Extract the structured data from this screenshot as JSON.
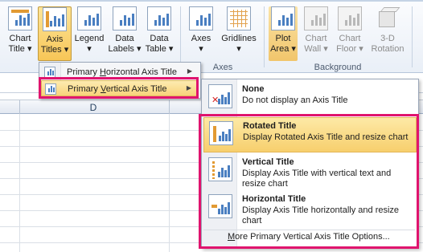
{
  "ribbon": {
    "buttons": [
      {
        "id": "chart-title",
        "line1": "Chart",
        "line2": "Title ▾"
      },
      {
        "id": "axis-titles",
        "line1": "Axis",
        "line2": "Titles ▾"
      },
      {
        "id": "legend",
        "line1": "Legend",
        "line2": "▾"
      },
      {
        "id": "data-labels",
        "line1": "Data",
        "line2": "Labels ▾"
      },
      {
        "id": "data-table",
        "line1": "Data",
        "line2": "Table ▾"
      },
      {
        "id": "axes",
        "line1": "Axes",
        "line2": "▾"
      },
      {
        "id": "gridlines",
        "line1": "Gridlines",
        "line2": "▾"
      },
      {
        "id": "plot-area",
        "line1": "Plot",
        "line2": "Area ▾"
      },
      {
        "id": "chart-wall",
        "line1": "Chart",
        "line2": "Wall ▾"
      },
      {
        "id": "chart-floor",
        "line1": "Chart",
        "line2": "Floor ▾"
      },
      {
        "id": "3d-rotation",
        "line1": "3-D",
        "line2": "Rotation"
      }
    ],
    "groups": {
      "axes": "Axes",
      "background": "Background"
    }
  },
  "sheet": {
    "column_label": "D"
  },
  "axis_titles_menu": {
    "items": [
      {
        "label_pre": "Primary ",
        "label_accel": "H",
        "label_post": "orizontal Axis Title"
      },
      {
        "label_pre": "Primary ",
        "label_accel": "V",
        "label_post": "ertical Axis Title"
      }
    ]
  },
  "vertical_axis_submenu": {
    "items": [
      {
        "title": "None",
        "desc": "Do not display an Axis Title"
      },
      {
        "title": "Rotated Title",
        "desc": "Display Rotated Axis Title and resize chart"
      },
      {
        "title": "Vertical Title",
        "desc": "Display Axis Title with vertical text and resize chart"
      },
      {
        "title": "Horizontal Title",
        "desc": "Display Axis Title horizontally and resize chart"
      }
    ],
    "more_accel": "M",
    "more_rest": "ore Primary Vertical Axis Title Options..."
  },
  "colors": {
    "highlight_box": "#e0146e",
    "hover_fill": "#f8d37a",
    "chart_bar": "#4a7fc1",
    "title_accent": "#e29a33"
  }
}
